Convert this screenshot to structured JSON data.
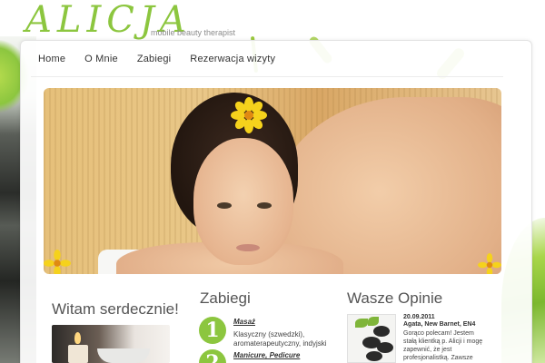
{
  "header": {
    "logo": "ALICJA",
    "tagline": "mobile beauty therapist"
  },
  "nav": {
    "items": [
      {
        "label": "Home"
      },
      {
        "label": "O Mnie"
      },
      {
        "label": "Zabiegi"
      },
      {
        "label": "Rezerwacja wizyty"
      }
    ]
  },
  "welcome": {
    "title": "Witam serdecznie!"
  },
  "services": {
    "title": "Zabiegi",
    "items": [
      {
        "number": "1",
        "name": "Masaż",
        "description": "Klasyczny (szwedzki), aromaterapeutyczny, indyjski"
      },
      {
        "number": "2",
        "name": "Manicure, Pedicure"
      }
    ]
  },
  "testimonials": {
    "title": "Wasze Opinie",
    "date": "20.09.2011",
    "author": "Agata, New Barnet, EN4",
    "text": "Gorąco polecam! Jestem stałą klientką p. Alicji i mogę zapewnić, że jest profesjonalistką. Zawsze"
  },
  "colors": {
    "accent": "#8cc63f",
    "text": "#333333",
    "heading": "#555555"
  }
}
